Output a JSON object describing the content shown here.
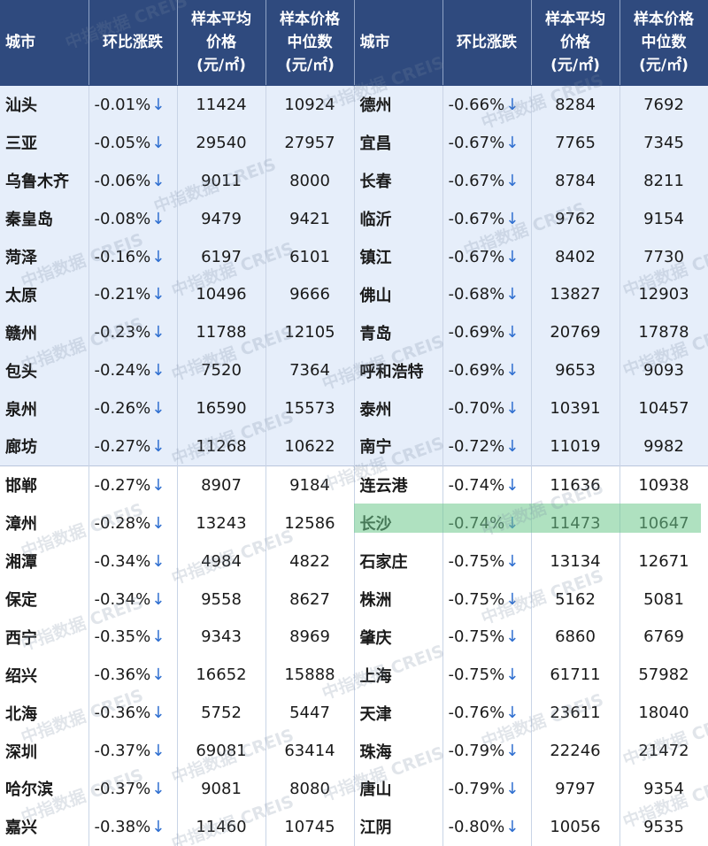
{
  "headers": {
    "city": "城市",
    "change": "环比涨跌",
    "avg_line1": "样本平均",
    "avg_line2": "价格",
    "avg_line3": "(元/㎡)",
    "median_line1": "样本价格",
    "median_line2": "中位数",
    "median_line3": "(元/㎡)"
  },
  "arrow": "↓",
  "highlight_color": "#6ec88c",
  "header_color": "#2f4a7e",
  "watermark": "中指数据 CREIS",
  "rows": [
    {
      "l": {
        "city": "汕头",
        "change": "-0.01%",
        "avg": "11424",
        "median": "10924"
      },
      "r": {
        "city": "德州",
        "change": "-0.66%",
        "avg": "8284",
        "median": "7692"
      }
    },
    {
      "l": {
        "city": "三亚",
        "change": "-0.05%",
        "avg": "29540",
        "median": "27957"
      },
      "r": {
        "city": "宜昌",
        "change": "-0.67%",
        "avg": "7765",
        "median": "7345"
      }
    },
    {
      "l": {
        "city": "乌鲁木齐",
        "change": "-0.06%",
        "avg": "9011",
        "median": "8000"
      },
      "r": {
        "city": "长春",
        "change": "-0.67%",
        "avg": "8784",
        "median": "8211"
      }
    },
    {
      "l": {
        "city": "秦皇岛",
        "change": "-0.08%",
        "avg": "9479",
        "median": "9421"
      },
      "r": {
        "city": "临沂",
        "change": "-0.67%",
        "avg": "9762",
        "median": "9154"
      }
    },
    {
      "l": {
        "city": "菏泽",
        "change": "-0.16%",
        "avg": "6197",
        "median": "6101"
      },
      "r": {
        "city": "镇江",
        "change": "-0.67%",
        "avg": "8402",
        "median": "7730"
      }
    },
    {
      "l": {
        "city": "太原",
        "change": "-0.21%",
        "avg": "10496",
        "median": "9666"
      },
      "r": {
        "city": "佛山",
        "change": "-0.68%",
        "avg": "13827",
        "median": "12903"
      }
    },
    {
      "l": {
        "city": "赣州",
        "change": "-0.23%",
        "avg": "11788",
        "median": "12105"
      },
      "r": {
        "city": "青岛",
        "change": "-0.69%",
        "avg": "20769",
        "median": "17878"
      }
    },
    {
      "l": {
        "city": "包头",
        "change": "-0.24%",
        "avg": "7520",
        "median": "7364"
      },
      "r": {
        "city": "呼和浩特",
        "change": "-0.69%",
        "avg": "9653",
        "median": "9093"
      }
    },
    {
      "l": {
        "city": "泉州",
        "change": "-0.26%",
        "avg": "16590",
        "median": "15573"
      },
      "r": {
        "city": "泰州",
        "change": "-0.70%",
        "avg": "10391",
        "median": "10457"
      }
    },
    {
      "l": {
        "city": "廊坊",
        "change": "-0.27%",
        "avg": "11268",
        "median": "10622"
      },
      "r": {
        "city": "南宁",
        "change": "-0.72%",
        "avg": "11019",
        "median": "9982"
      }
    },
    {
      "l": {
        "city": "邯郸",
        "change": "-0.27%",
        "avg": "8907",
        "median": "9184"
      },
      "r": {
        "city": "连云港",
        "change": "-0.74%",
        "avg": "11636",
        "median": "10938"
      }
    },
    {
      "l": {
        "city": "漳州",
        "change": "-0.28%",
        "avg": "13243",
        "median": "12586"
      },
      "r": {
        "city": "长沙",
        "change": "-0.74%",
        "avg": "11473",
        "median": "10647"
      }
    },
    {
      "l": {
        "city": "湘潭",
        "change": "-0.34%",
        "avg": "4984",
        "median": "4822"
      },
      "r": {
        "city": "石家庄",
        "change": "-0.75%",
        "avg": "13134",
        "median": "12671"
      }
    },
    {
      "l": {
        "city": "保定",
        "change": "-0.34%",
        "avg": "9558",
        "median": "8627"
      },
      "r": {
        "city": "株洲",
        "change": "-0.75%",
        "avg": "5162",
        "median": "5081"
      }
    },
    {
      "l": {
        "city": "西宁",
        "change": "-0.35%",
        "avg": "9343",
        "median": "8969"
      },
      "r": {
        "city": "肇庆",
        "change": "-0.75%",
        "avg": "6860",
        "median": "6769"
      }
    },
    {
      "l": {
        "city": "绍兴",
        "change": "-0.36%",
        "avg": "16652",
        "median": "15888"
      },
      "r": {
        "city": "上海",
        "change": "-0.75%",
        "avg": "61711",
        "median": "57982"
      }
    },
    {
      "l": {
        "city": "北海",
        "change": "-0.36%",
        "avg": "5752",
        "median": "5447"
      },
      "r": {
        "city": "天津",
        "change": "-0.76%",
        "avg": "23611",
        "median": "18040"
      }
    },
    {
      "l": {
        "city": "深圳",
        "change": "-0.37%",
        "avg": "69081",
        "median": "63414"
      },
      "r": {
        "city": "珠海",
        "change": "-0.79%",
        "avg": "22246",
        "median": "21472"
      }
    },
    {
      "l": {
        "city": "哈尔滨",
        "change": "-0.37%",
        "avg": "9081",
        "median": "8080"
      },
      "r": {
        "city": "唐山",
        "change": "-0.79%",
        "avg": "9797",
        "median": "9354"
      }
    },
    {
      "l": {
        "city": "嘉兴",
        "change": "-0.38%",
        "avg": "11460",
        "median": "10745"
      },
      "r": {
        "city": "江阴",
        "change": "-0.80%",
        "avg": "10056",
        "median": "9535"
      }
    }
  ]
}
